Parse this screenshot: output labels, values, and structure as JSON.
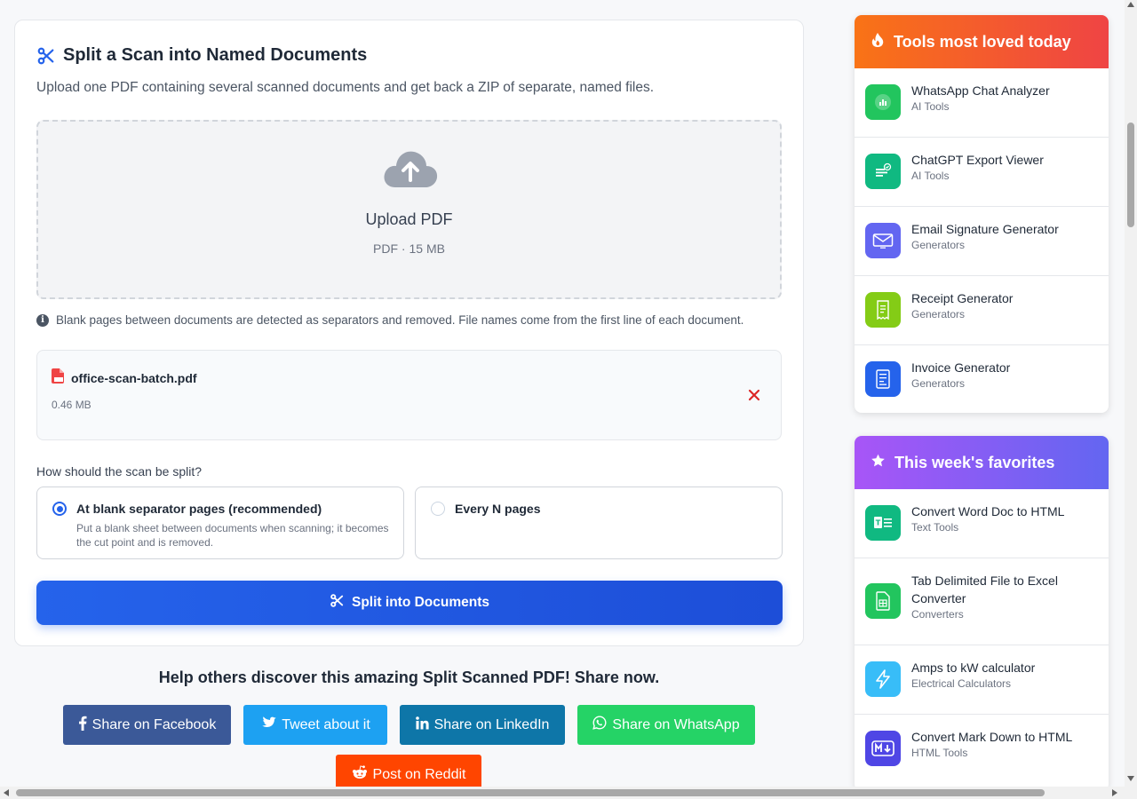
{
  "main": {
    "title": "Split a Scan into Named Documents",
    "subtitle": "Upload one PDF containing several scanned documents and get back a ZIP of separate, named files.",
    "upload": {
      "title": "Upload PDF",
      "subtitle": "PDF · 15 MB",
      "icon": "cloud-upload-icon"
    },
    "info_text": "Blank pages between documents are detected as separators and removed. File names come from the first line of each document.",
    "file": {
      "name": "office-scan-batch.pdf",
      "size": "0.46 MB"
    },
    "split_question": "How should the scan be split?",
    "options": [
      {
        "label": "At blank separator pages (recommended)",
        "description": "Put a blank sheet between documents when scanning; it becomes the cut point and is removed.",
        "selected": true
      },
      {
        "label": "Every N pages",
        "description": "",
        "selected": false
      }
    ],
    "split_button": "Split into Documents",
    "accent_color": "#2563eb"
  },
  "share": {
    "title": "Help others discover this amazing Split Scanned PDF! Share now.",
    "buttons": [
      {
        "label": "Share on Facebook",
        "color": "#3b5998"
      },
      {
        "label": "Tweet about it",
        "color": "#1da1f2"
      },
      {
        "label": "Share on LinkedIn",
        "color": "#0e76a8"
      },
      {
        "label": "Share on WhatsApp",
        "color": "#25d366"
      },
      {
        "label": "Post on Reddit",
        "color": "#ff4500"
      }
    ]
  },
  "sidebar": {
    "loved": {
      "title": "Tools most loved today",
      "items": [
        {
          "name": "WhatsApp Chat Analyzer",
          "category": "AI Tools",
          "icon": "chart-bars-icon",
          "color": "#22c55e"
        },
        {
          "name": "ChatGPT Export Viewer",
          "category": "AI Tools",
          "icon": "chat-check-icon",
          "color": "#10b981"
        },
        {
          "name": "Email Signature Generator",
          "category": "Generators",
          "icon": "envelope-icon",
          "color": "#6366f1"
        },
        {
          "name": "Receipt Generator",
          "category": "Generators",
          "icon": "receipt-icon",
          "color": "#84cc16"
        },
        {
          "name": "Invoice Generator",
          "category": "Generators",
          "icon": "invoice-icon",
          "color": "#2563eb"
        }
      ]
    },
    "favorites": {
      "title": "This week's favorites",
      "items": [
        {
          "name": "Convert Word Doc to HTML",
          "category": "Text Tools",
          "icon": "word-doc-icon",
          "color": "#10b981"
        },
        {
          "name": "Tab Delimited File to Excel Converter",
          "category": "Converters",
          "icon": "spreadsheet-icon",
          "color": "#22c55e"
        },
        {
          "name": "Amps to kW calculator",
          "category": "Electrical Calculators",
          "icon": "lightning-icon",
          "color": "#38bdf8"
        },
        {
          "name": "Convert Mark Down to HTML",
          "category": "HTML Tools",
          "icon": "markdown-icon",
          "color": "#4f46e5"
        }
      ]
    }
  }
}
